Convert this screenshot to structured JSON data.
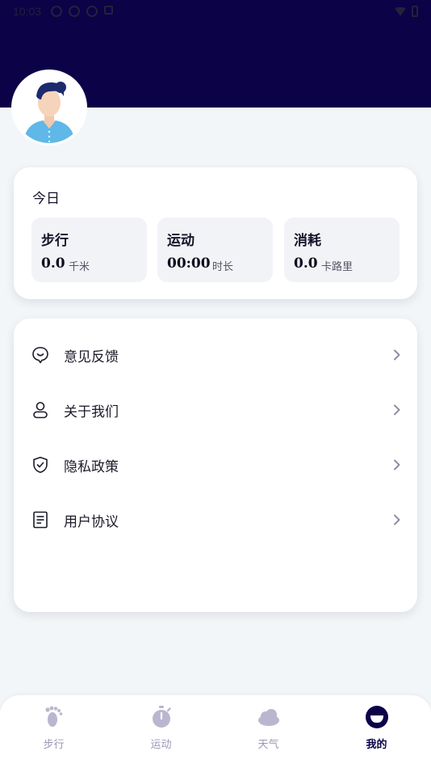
{
  "status_bar": {
    "time": "10:03"
  },
  "today": {
    "title": "今日",
    "stats": [
      {
        "label": "步行",
        "value": "0.0",
        "unit": "千米"
      },
      {
        "label": "运动",
        "value": "00:00",
        "unit": "时长"
      },
      {
        "label": "消耗",
        "value": "0.0",
        "unit": "卡路里"
      }
    ]
  },
  "menu": {
    "items": [
      {
        "label": "意见反馈",
        "icon": "feedback-icon"
      },
      {
        "label": "关于我们",
        "icon": "user-icon"
      },
      {
        "label": "隐私政策",
        "icon": "shield-icon"
      },
      {
        "label": "用户协议",
        "icon": "document-icon"
      }
    ]
  },
  "tabbar": {
    "tabs": [
      {
        "label": "步行",
        "icon": "footprint-icon",
        "active": false
      },
      {
        "label": "运动",
        "icon": "stopwatch-icon",
        "active": false
      },
      {
        "label": "天气",
        "icon": "cloud-icon",
        "active": false
      },
      {
        "label": "我的",
        "icon": "smile-icon",
        "active": true
      }
    ]
  },
  "colors": {
    "header": "#0b0248",
    "background": "#f3f6f8",
    "accent": "#0b0248",
    "inactive_tab": "#9a98b4"
  }
}
